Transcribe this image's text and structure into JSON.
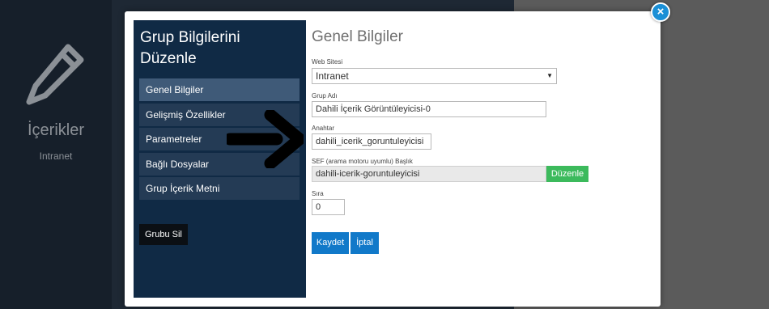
{
  "background": {
    "section_title": "İçerikler",
    "section_subtitle": "Intranet"
  },
  "modal": {
    "close_label": "×",
    "sidebar": {
      "title": "Grup Bilgilerini Düzenle",
      "items": [
        {
          "label": "Genel Bilgiler",
          "active": true
        },
        {
          "label": "Gelişmiş Özellikler",
          "active": false
        },
        {
          "label": "Parametreler",
          "active": false
        },
        {
          "label": "Bağlı Dosyalar",
          "active": false
        },
        {
          "label": "Grup İçerik Metni",
          "active": false
        }
      ],
      "delete_button": "Grubu Sil"
    },
    "form": {
      "heading": "Genel Bilgiler",
      "website_label": "Web Sitesi",
      "website_value": "Intranet",
      "group_name_label": "Grup Adı",
      "group_name_value": "Dahili İçerik Görüntüleyicisi-0",
      "key_label": "Anahtar",
      "key_value": "dahili_icerik_goruntuleyicisi",
      "sef_label": "SEF (arama motoru uyumlu) Başlık",
      "sef_value": "dahili-icerik-goruntuleyicisi",
      "sef_edit_button": "Düzenle",
      "order_label": "Sıra",
      "order_value": "0",
      "save_button": "Kaydet",
      "cancel_button": "İptal"
    }
  },
  "colors": {
    "sidebar_bg": "#102a45",
    "sidebar_item": "#243b55",
    "sidebar_item_active": "#3f5a78",
    "primary": "#1179c9",
    "success": "#3cba5c"
  },
  "icons": [
    "pencil-icon",
    "close-icon",
    "dropdown-arrow-icon",
    "pointer-arrow-icon"
  ]
}
